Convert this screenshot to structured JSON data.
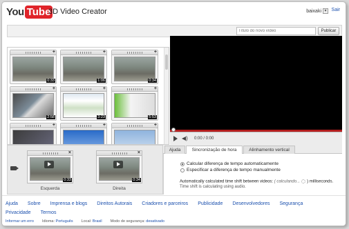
{
  "header": {
    "logo_you": "You",
    "logo_tube": "Tube",
    "app_title": "3D Video Creator",
    "username": "baixaki",
    "signout_label": "Sair"
  },
  "toolbar": {
    "title_placeholder": "Título do novo vídeo",
    "publish_label": "Publicar"
  },
  "library": {
    "icon": "plus-icon",
    "durations": [
      "0:33",
      "1:06",
      "0:34",
      "2:58",
      "3:23",
      "5:53",
      "",
      "",
      ""
    ]
  },
  "player": {
    "time": "0:00 / 0:00",
    "progress": 0
  },
  "timeline": {
    "left_label": "Esquerda",
    "right_label": "Direita",
    "left_duration": "0:33",
    "right_duration": "0:34"
  },
  "tabs": [
    {
      "label": "Ajuda"
    },
    {
      "label": "Sincronização de hora"
    },
    {
      "label": "Alinhamento vertical"
    }
  ],
  "sync": {
    "option_auto": "Calcular diferença de tempo automaticamente",
    "option_manual": "Especificar a diferença de tempo manualmente",
    "auto_text": "Automatically calculated time shift between videos:",
    "calculating": "( calculando...",
    "ms": ") milliseconds.",
    "note": "Time shift is calculating using audio."
  },
  "footer": {
    "links": [
      "Ajuda",
      "Sobre",
      "Imprensa e blogs",
      "Direitos Autorais",
      "Criadores e parceiros",
      "Publicidade",
      "Desenvolvedores",
      "Segurança",
      "Privacidade",
      "Termos"
    ],
    "report_error": "Informar um erro",
    "language_label": "Idioma:",
    "language_value": "Português",
    "location_label": "Local:",
    "location_value": "Brasil",
    "safety_label": "Modo de segurança:",
    "safety_value": "desativado"
  },
  "colors": {
    "accent_red": "#e0242a",
    "link_blue": "#1a4fad",
    "progress_red": "#b41e1e"
  }
}
